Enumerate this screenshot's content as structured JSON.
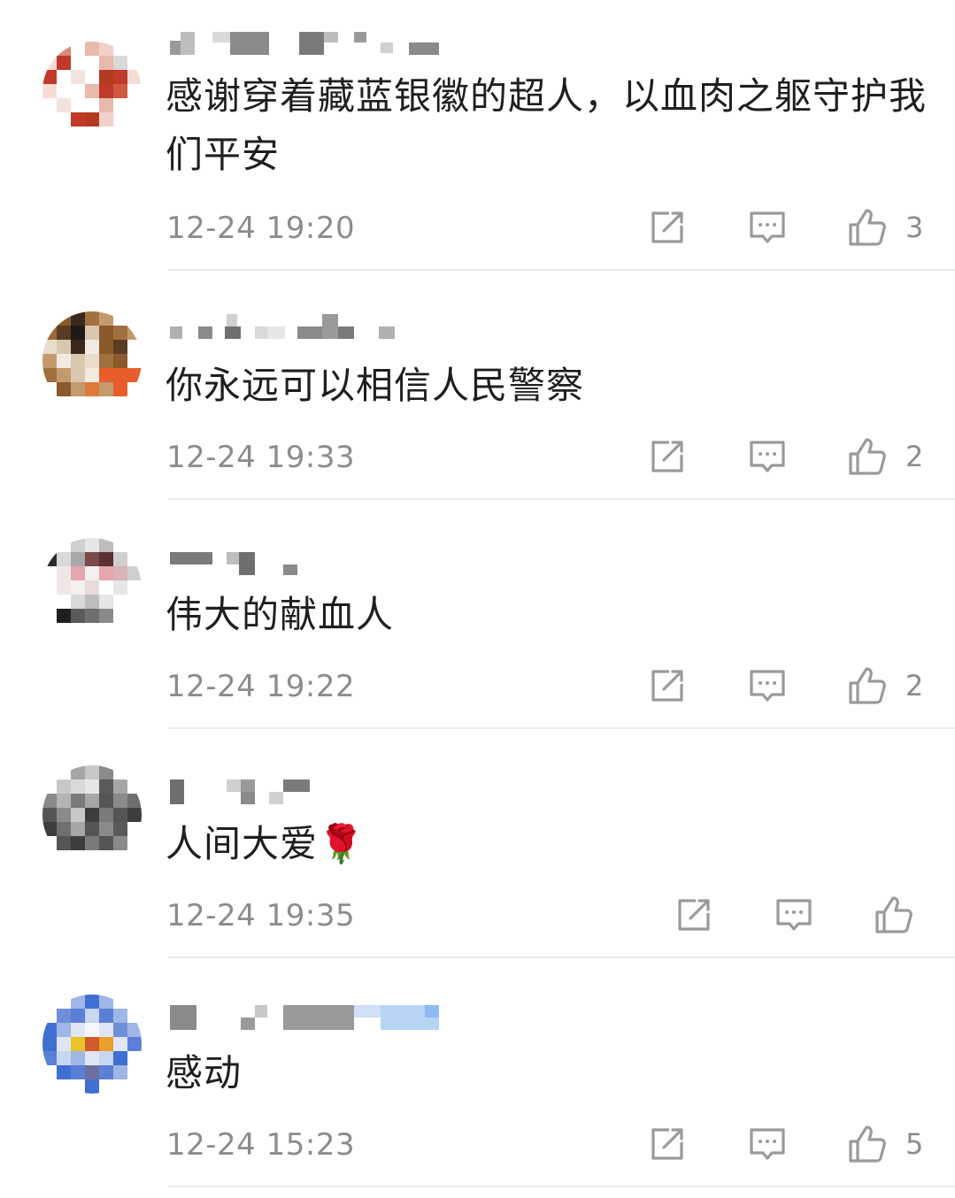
{
  "comments": [
    {
      "username": "",
      "text": "感谢穿着藏蓝银徽的超人，以血肉之躯守护我们平安",
      "time": "12-24 19:20",
      "likes": "3",
      "avatar_colors": [
        "#c0392b",
        "#e8b9ad",
        "#f5ddd6",
        "#b33a20",
        "#d9d9d9"
      ]
    },
    {
      "username": "",
      "text": "你永远可以相信人民警察",
      "time": "12-24 19:33",
      "likes": "2",
      "avatar_colors": [
        "#8b5a2b",
        "#3a2a1d",
        "#d9c7b0",
        "#e85d2c",
        "#c49a6c"
      ]
    },
    {
      "username": "",
      "text": "伟大的献血人",
      "time": "12-24 19:22",
      "likes": "2",
      "avatar_colors": [
        "#2b2b2b",
        "#e6a6ad",
        "#f0e6e6",
        "#7a4a4a",
        "#cfcfcf"
      ]
    },
    {
      "username": "",
      "text": "人间大爱🌹",
      "time": "12-24 19:35",
      "likes": "",
      "avatar_colors": [
        "#555555",
        "#8a8a8a",
        "#c8c8c8",
        "#3d3d3d",
        "#a6a6a6"
      ]
    },
    {
      "username": "",
      "text": "感动",
      "time": "12-24 15:23",
      "likes": "5",
      "avatar_colors": [
        "#3f6fd1",
        "#e8c42a",
        "#9fb6e6",
        "#e0e6f5",
        "#d05a2a"
      ]
    }
  ],
  "icons": {
    "share": "share-icon",
    "reply": "comment-icon",
    "like": "thumbs-up-icon"
  },
  "colors": {
    "text": "#1f1f1f",
    "meta": "#8c8c8c",
    "divider": "#ececec"
  }
}
